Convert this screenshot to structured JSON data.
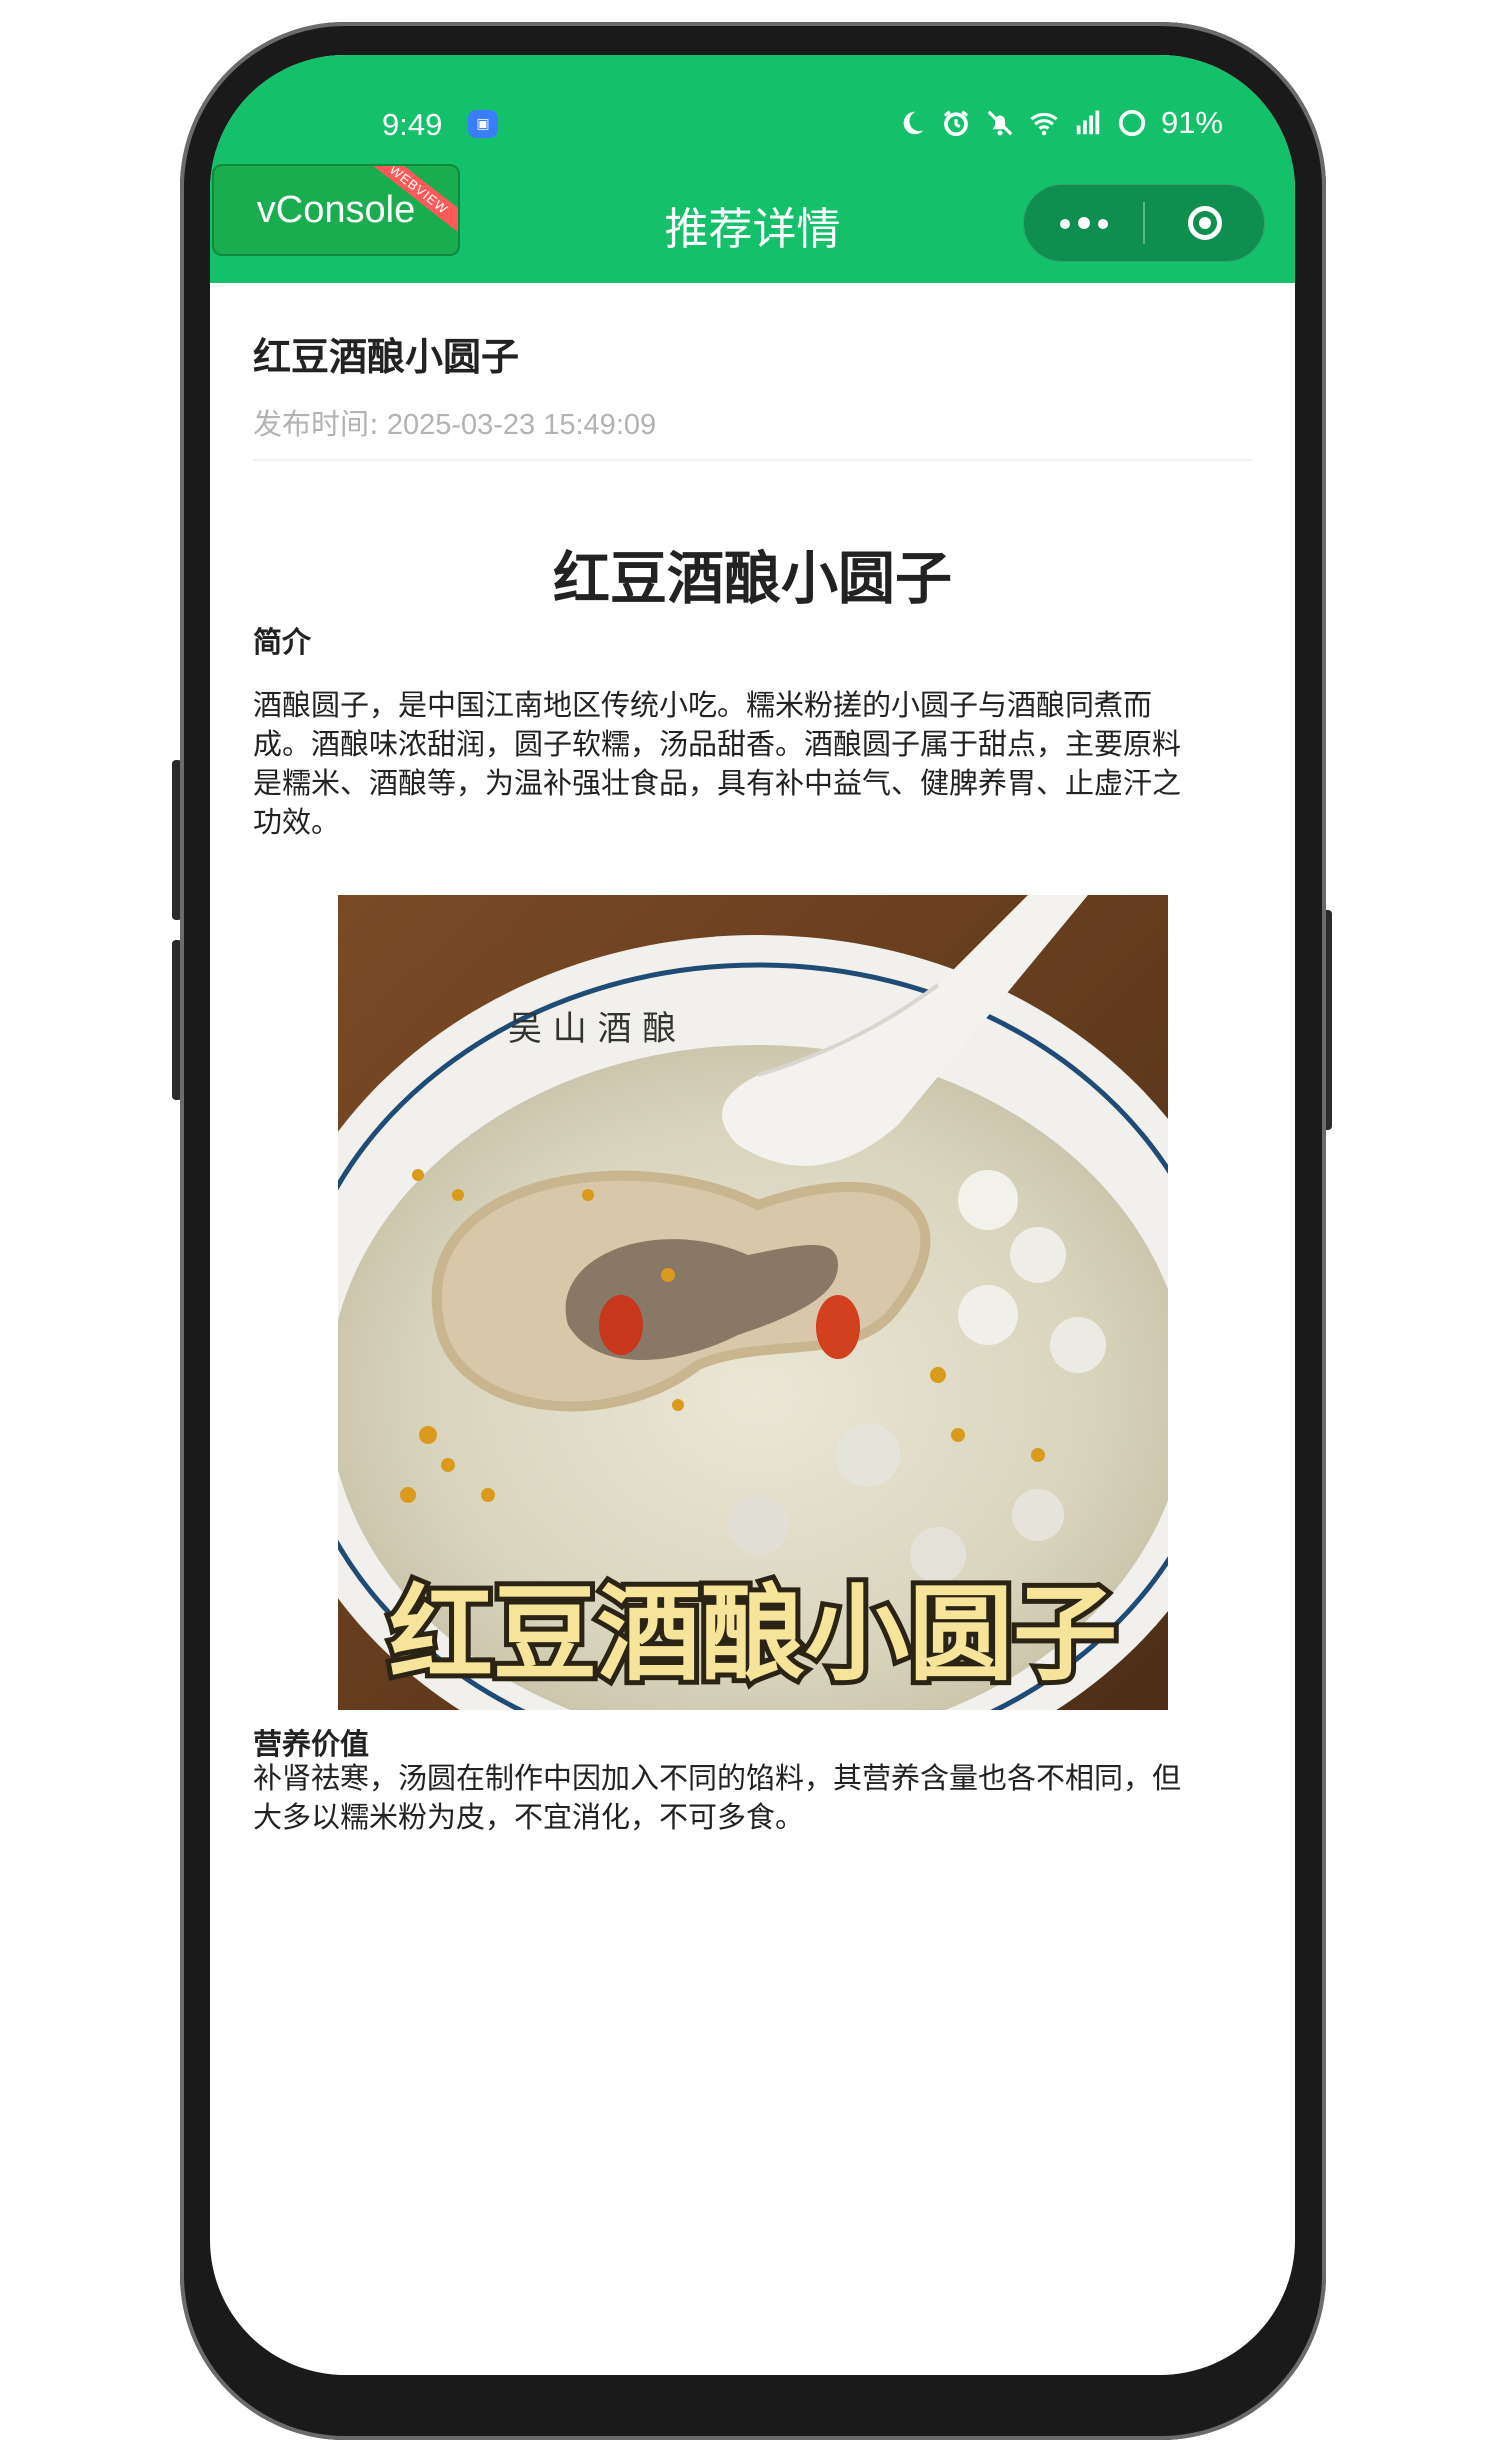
{
  "status_bar": {
    "time": "9:49",
    "battery": "91%",
    "icons": [
      "moon-icon",
      "alarm-icon",
      "mute-icon",
      "wifi-icon",
      "signal-icon",
      "battery-icon"
    ]
  },
  "vconsole": {
    "label": "vConsole",
    "tag": "WEBVIEW"
  },
  "nav": {
    "title": "推荐详情"
  },
  "article": {
    "title": "红豆酒酿小圆子",
    "publish_label": "发布时间:",
    "publish_time": "2025-03-23 15:49:09",
    "body_title": "红豆酒酿小圆子",
    "intro_heading": "简介",
    "intro_lines": [
      "酒酿圆子，是中国江南地区传统小吃。糯米粉搓的小圆子与酒酿同煮而",
      "成。酒酿味浓甜润，圆子软糯，汤品甜香。酒酿圆子属于甜点，主要原料",
      "是糯米、酒酿等，为温补强壮食品，具有补中益气、健脾养胃、止虚汗之",
      "功效。"
    ],
    "image_caption": "红豆酒酿小圆子",
    "bowl_text": "吴 山 酒 酿",
    "nutrition_heading": "营养价值",
    "nutrition_lines": [
      "补肾祛寒，汤圆在制作中因加入不同的馅料，其营养含量也各不相同，但",
      "大多以糯米粉为皮，不宜消化，不可多食。"
    ]
  },
  "colors": {
    "header_green": "#15c06b",
    "capsule_green": "#0f8f4f",
    "vconsole_green": "#1aad4f",
    "webview_tag": "#ff5a5a",
    "meta_gray": "#b3b3b3"
  }
}
